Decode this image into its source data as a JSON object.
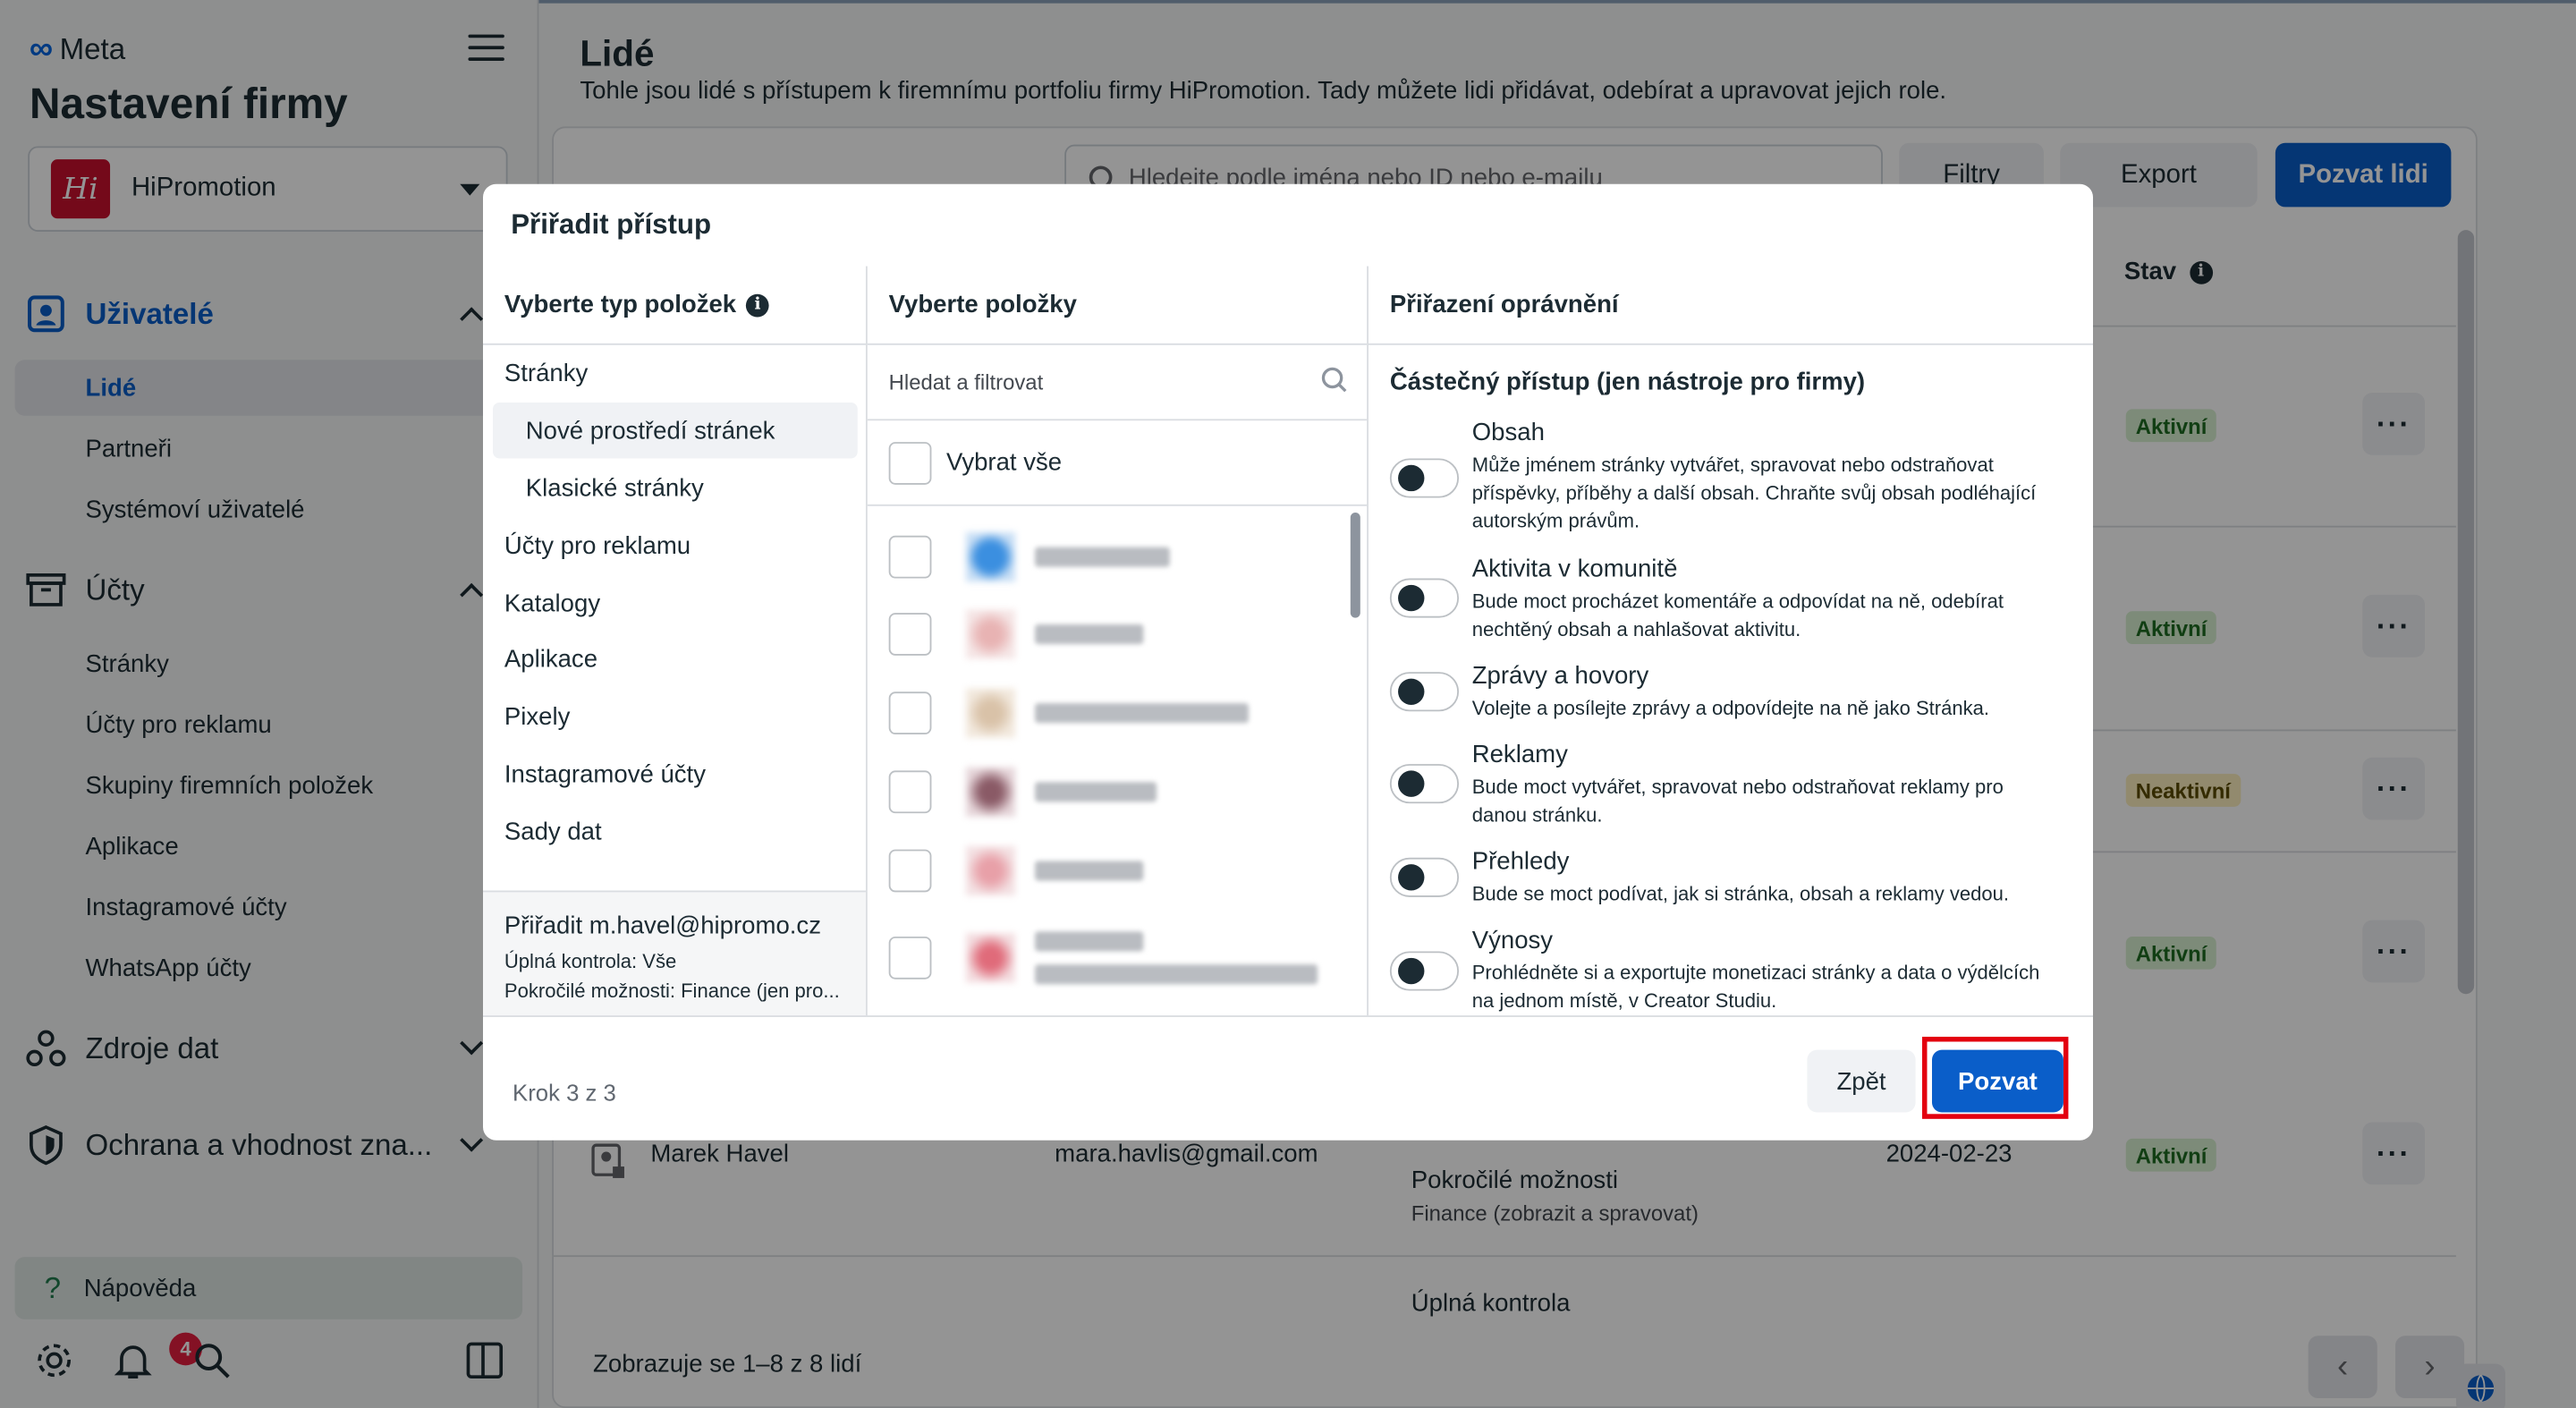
{
  "brand": "Meta",
  "app_title": "Nastavení firmy",
  "business": {
    "name": "HiPromotion",
    "logo_text": "Hi"
  },
  "nav": {
    "users_section": "Uživatelé",
    "users_items": [
      "Lidé",
      "Partneři",
      "Systémoví uživatelé"
    ],
    "accounts_section": "Účty",
    "accounts_items": [
      "Stránky",
      "Účty pro reklamu",
      "Skupiny firemních položek",
      "Aplikace",
      "Instagramové účty",
      "WhatsApp účty"
    ],
    "data_sources": "Zdroje dat",
    "brand_safety": "Ochrana a vhodnost zna...",
    "help": "Nápověda",
    "notifications_count": "4"
  },
  "main": {
    "title": "Lidé",
    "subtitle": "Tohle jsou lidé s přístupem k firemnímu portfoliu firmy HiPromotion. Tady můžete lidi přidávat, odebírat a upravovat jejich role.",
    "search_placeholder": "Hledejte podle jména nebo ID nebo e-mailu",
    "filters": "Filtry",
    "export": "Export",
    "invite": "Pozvat lidi",
    "status_header": "Stav",
    "statuses": [
      "Aktivní",
      "Aktivní",
      "Neaktivní",
      "Aktivní",
      "Aktivní"
    ],
    "row_name": "Marek Havel",
    "row_email": "mara.havlis@gmail.com",
    "row_date": "2024-02-23",
    "row_access_title": "Pokročilé možnosti",
    "row_access_desc": "Finance (zobrazit a spravovat)",
    "row_full_control": "Úplná kontrola",
    "pagination": "Zobrazuje se 1–8 z 8 lidí"
  },
  "modal": {
    "title": "Přiřadit přístup",
    "col1_header": "Vyberte typ položek",
    "col2_header": "Vyberte položky",
    "col3_header": "Přiřazení oprávnění",
    "types": [
      "Stránky",
      "Nové prostředí stránek",
      "Klasické stránky",
      "Účty pro reklamu",
      "Katalogy",
      "Aplikace",
      "Pixely",
      "Instagramové účty",
      "Sady dat"
    ],
    "assign_title": "Přiřadit m.havel@hipromo.cz",
    "assign_line1": "Úplná kontrola: Vše",
    "assign_line2": "Pokročilé možnosti: Finance (jen pro...",
    "filter_placeholder": "Hledat a filtrovat",
    "select_all": "Vybrat vše",
    "partial_access": "Částečný přístup (jen nástroje pro firmy)",
    "permissions": [
      {
        "title": "Obsah",
        "desc": "Může jménem stránky vytvářet, spravovat nebo odstraňovat příspěvky, příběhy a další obsah. Chraňte svůj obsah podléhající autorským právům."
      },
      {
        "title": "Aktivita v komunitě",
        "desc": "Bude moct procházet komentáře a odpovídat na ně, odebírat nechtěný obsah a nahlašovat aktivitu."
      },
      {
        "title": "Zprávy a hovory",
        "desc": "Volejte a posílejte zprávy a odpovídejte na ně jako Stránka."
      },
      {
        "title": "Reklamy",
        "desc": "Bude moct vytvářet, spravovat nebo odstraňovat reklamy pro danou stránku."
      },
      {
        "title": "Přehledy",
        "desc": "Bude se moct podívat, jak si stránka, obsah a reklamy vedou."
      },
      {
        "title": "Výnosy",
        "desc": "Prohlédněte si a exportujte monetizaci stránky a data o výdělcích na jednom místě, v Creator Studiu."
      }
    ],
    "step": "Krok 3 z 3",
    "back": "Zpět",
    "invite": "Pozvat"
  }
}
